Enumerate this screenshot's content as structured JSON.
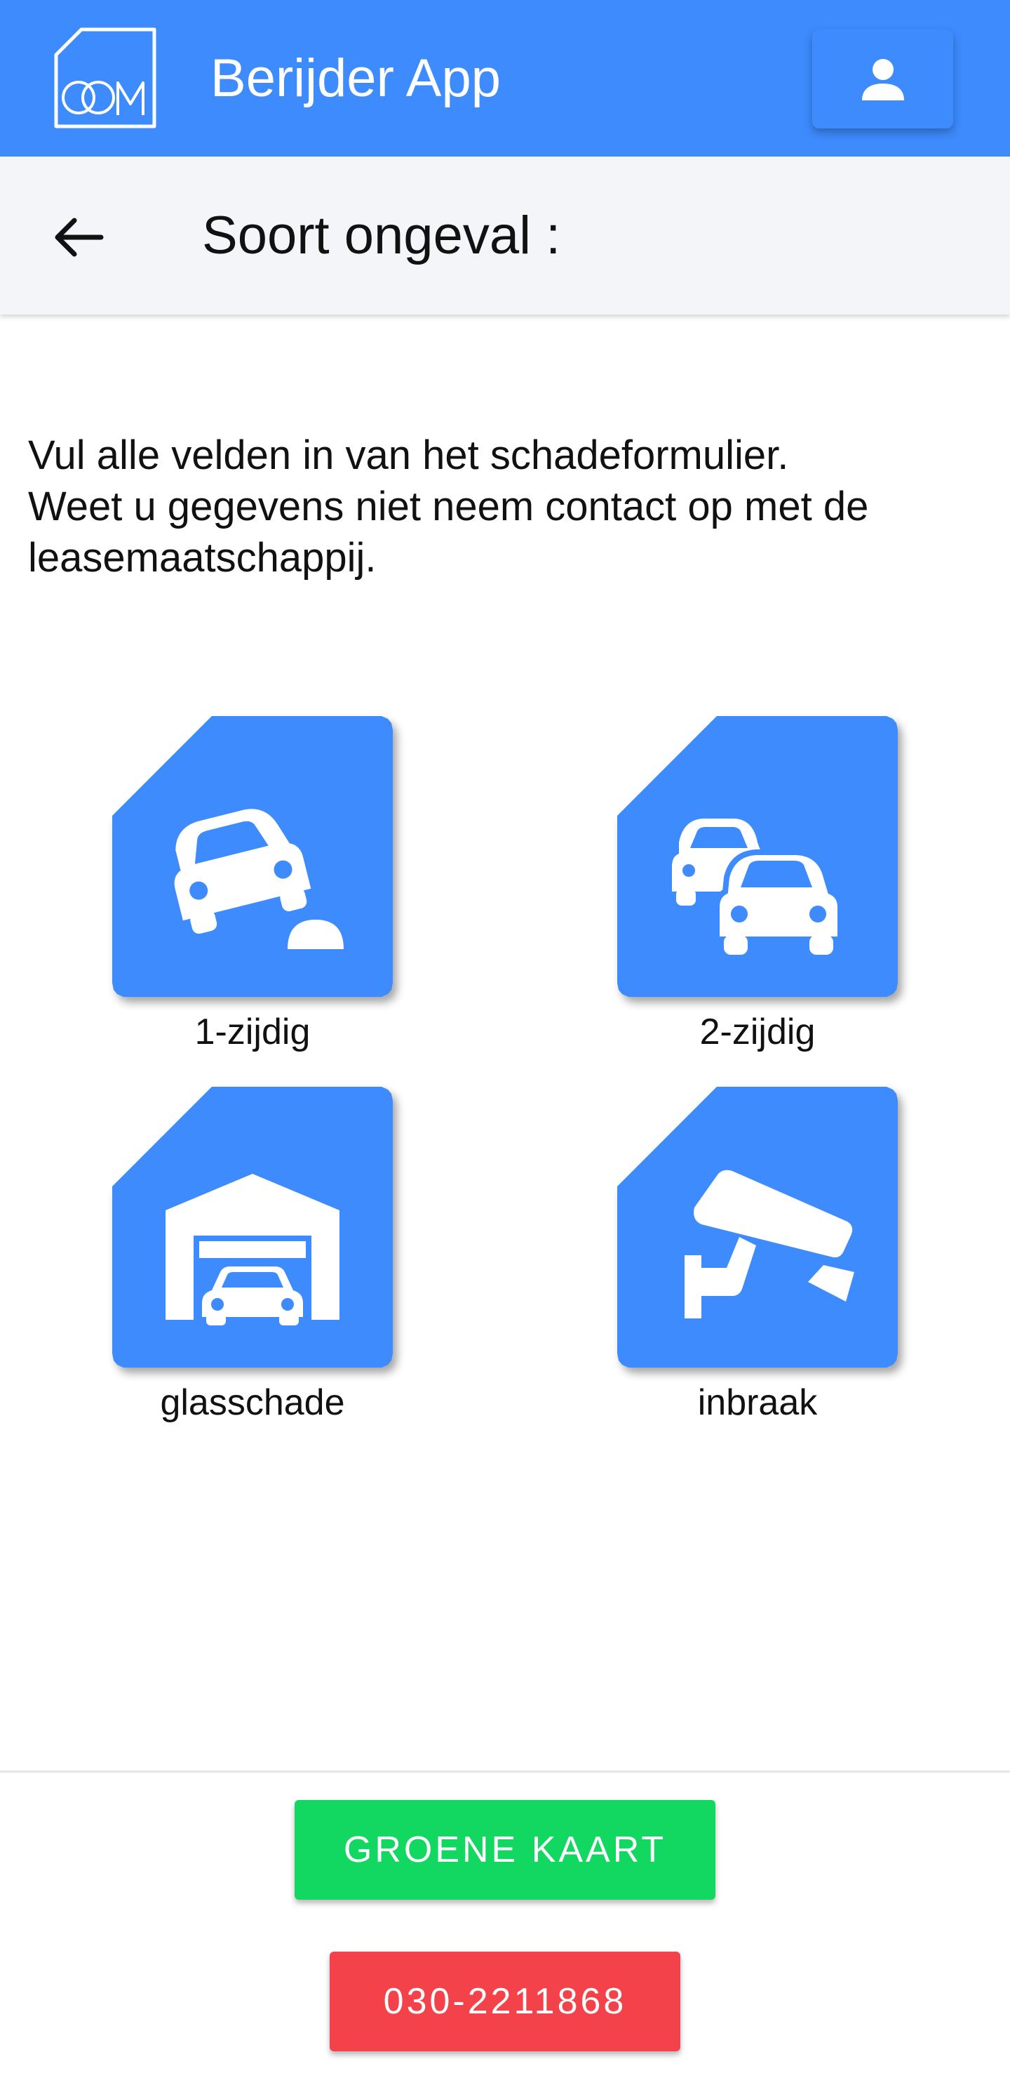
{
  "header": {
    "app_title": "Berijder App",
    "logo_text": "OCM",
    "accent_color": "#3d8bfd",
    "user_icon": "person-icon"
  },
  "subheader": {
    "back_icon": "arrow-left-icon",
    "title": "Soort ongeval :"
  },
  "intro": {
    "line1": "Vul alle velden in van het schadeformulier.",
    "line2": "Weet u gegevens niet neem contact op met de",
    "line3": "leasemaatschappij."
  },
  "tiles": [
    {
      "label": "1-zijdig",
      "icon": "single-car-accident-icon"
    },
    {
      "label": "2-zijdig",
      "icon": "two-cars-icon"
    },
    {
      "label": "glasschade",
      "icon": "garage-car-icon"
    },
    {
      "label": "inbraak",
      "icon": "security-camera-icon"
    }
  ],
  "footer": {
    "green_card_label": "GROENE KAART",
    "green_color": "#12d760",
    "phone_label": "030-2211868",
    "red_color": "#f4424a"
  }
}
